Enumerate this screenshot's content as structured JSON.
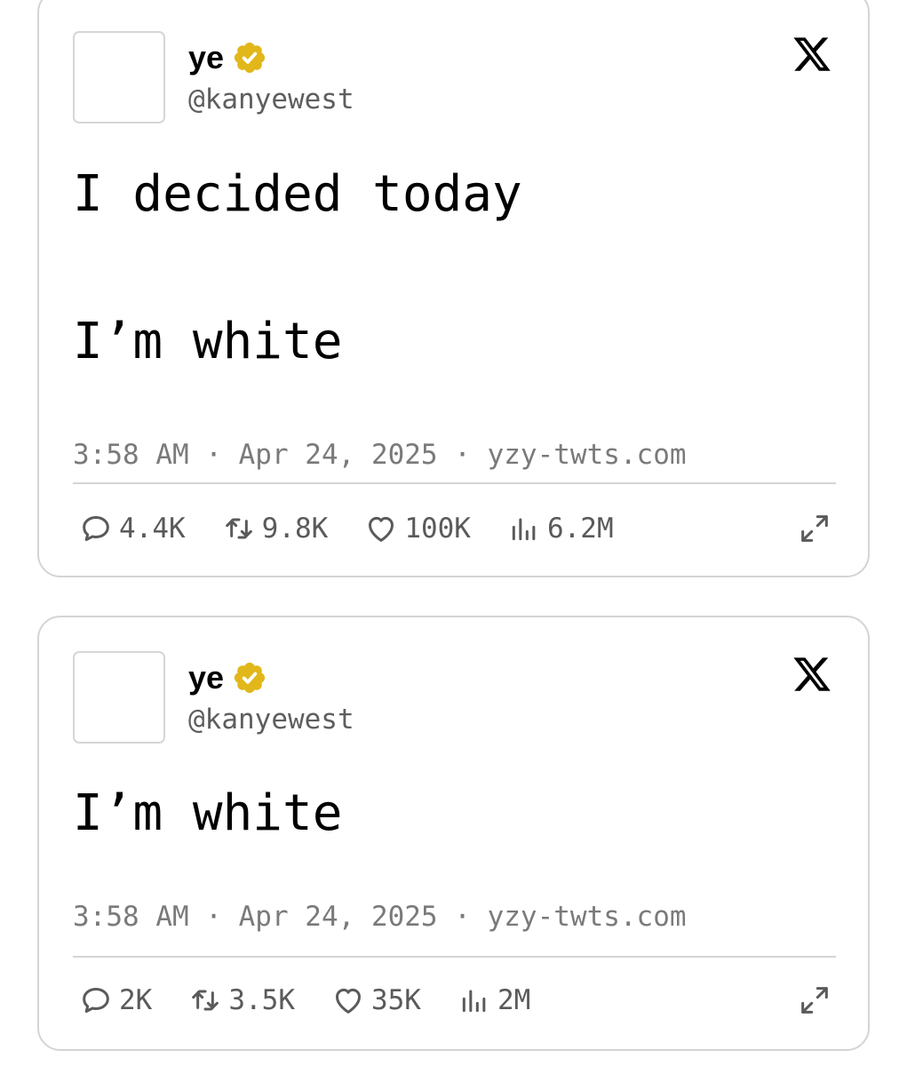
{
  "tweets": [
    {
      "display_name": "ye",
      "handle": "@kanyewest",
      "text_lines": [
        "I decided today",
        "I’m white"
      ],
      "meta": "3:58 AM · Apr 24, 2025 · yzy-twts.com",
      "replies": "4.4K",
      "reposts": "9.8K",
      "likes": "100K",
      "views": "6.2M"
    },
    {
      "display_name": "ye",
      "handle": "@kanyewest",
      "text_lines": [
        "I’m white"
      ],
      "meta": "3:58 AM · Apr 24, 2025 · yzy-twts.com",
      "replies": "2K",
      "reposts": "3.5K",
      "likes": "35K",
      "views": "2M"
    }
  ],
  "icons": {
    "verified": "verified-badge-icon",
    "brand": "x-logo-icon",
    "reply": "reply-icon",
    "repost": "repost-icon",
    "like": "heart-icon",
    "views": "views-icon",
    "expand": "expand-icon"
  },
  "colors": {
    "verified_gold": "#e2b719",
    "border": "#d4d4d4",
    "muted_text": "#7a7a7a",
    "stat_text": "#5a5a5a"
  }
}
